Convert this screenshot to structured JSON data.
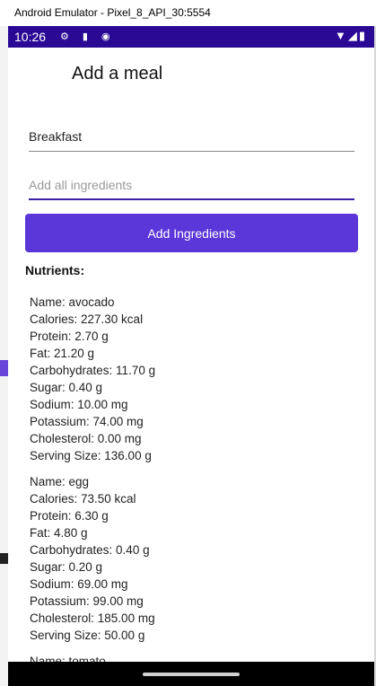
{
  "window": {
    "title": "Android Emulator - Pixel_8_API_30:5554"
  },
  "status_bar": {
    "time": "10:26",
    "left_icons": "⚙ ▮ ◉",
    "right_icons": "▼◢▮"
  },
  "header": {
    "title": "Add a meal"
  },
  "form": {
    "meal_value": "Breakfast",
    "ingredients_placeholder": "Add all ingredients",
    "add_button": "Add Ingredients"
  },
  "nutrients": {
    "title": "Nutrients:",
    "items": [
      {
        "name": "Name: avocado",
        "calories": "Calories: 227.30 kcal",
        "protein": "Protein: 2.70 g",
        "fat": "Fat: 21.20 g",
        "carbs": "Carbohydrates: 11.70 g",
        "sugar": "Sugar: 0.40 g",
        "sodium": "Sodium: 10.00 mg",
        "potassium": "Potassium: 74.00 mg",
        "cholesterol": "Cholesterol: 0.00 mg",
        "serving": "Serving Size: 136.00 g"
      },
      {
        "name": "Name: egg",
        "calories": "Calories: 73.50 kcal",
        "protein": "Protein: 6.30 g",
        "fat": "Fat: 4.80 g",
        "carbs": "Carbohydrates: 0.40 g",
        "sugar": "Sugar: 0.20 g",
        "sodium": "Sodium: 69.00 mg",
        "potassium": "Potassium: 99.00 mg",
        "cholesterol": "Cholesterol: 185.00 mg",
        "serving": "Serving Size: 50.00 g"
      },
      {
        "name": "Name: tomato"
      }
    ]
  },
  "colors": {
    "status_bar": "#2a0a95",
    "button": "#5b36d8",
    "focus_underline": "#3b1fa8"
  }
}
